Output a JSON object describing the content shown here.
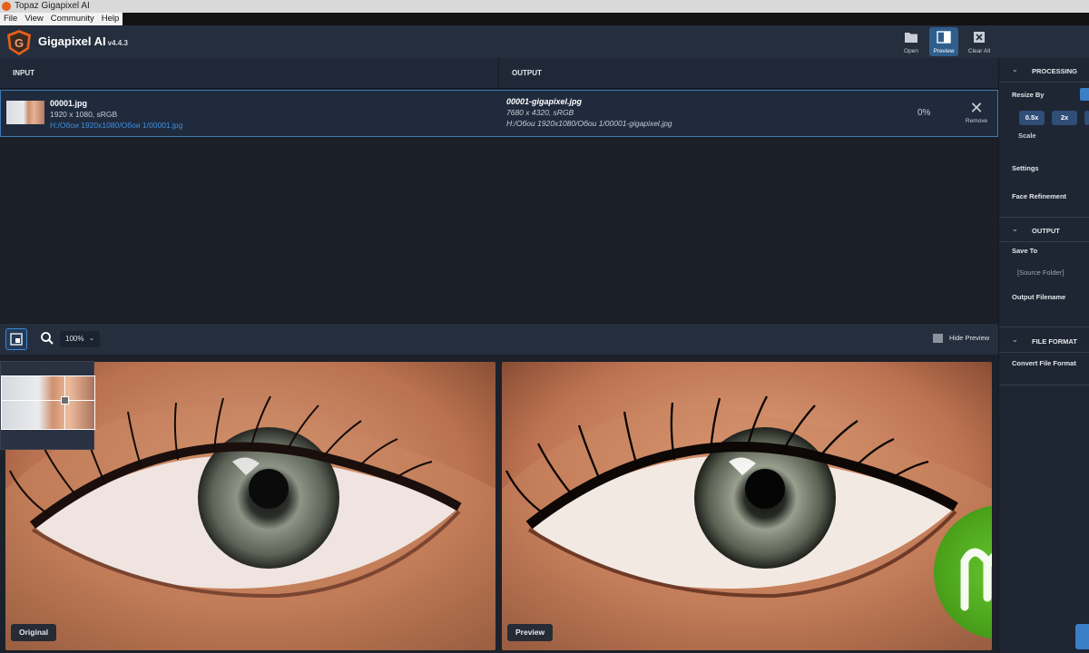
{
  "window": {
    "title": "Topaz Gigapixel AI"
  },
  "menu": {
    "items": [
      "File",
      "View",
      "Community",
      "Help"
    ]
  },
  "app": {
    "name": "Gigapixel AI",
    "version": "v4.4.3"
  },
  "toolbar": {
    "open_label": "Open",
    "preview_label": "Preview",
    "clear_label": "Clear All"
  },
  "table": {
    "input_header": "INPUT",
    "output_header": "OUTPUT",
    "row": {
      "input_name": "00001.jpg",
      "input_meta": "1920 x 1080, sRGB",
      "input_path": "H:/Обои 1920x1080/Обои 1/00001.jpg",
      "output_name": "00001-gigapixel.jpg",
      "output_meta": "7680 x 4320, sRGB",
      "output_path": "H:/Обои 1920x1080/Обои 1/00001-gigapixel.jpg",
      "progress": "0%",
      "remove_label": "Remove"
    }
  },
  "preview_toolbar": {
    "zoom": "100%",
    "hide_label": "Hide Preview"
  },
  "preview": {
    "original_label": "Original",
    "preview_label": "Preview"
  },
  "right_panel": {
    "processing_header": "PROCESSING",
    "resize_by": "Resize By",
    "scale_buttons": [
      "0.5x",
      "2x"
    ],
    "scale_label": "Scale",
    "settings": "Settings",
    "face_refinement": "Face Refinement",
    "output_header": "OUTPUT",
    "save_to": "Save To",
    "save_to_value": "[Source Folder]",
    "output_filename": "Output Filename",
    "file_format_header": "FILE FORMAT",
    "convert_file_format": "Convert File Format"
  },
  "colors": {
    "accent": "#3b7fc9",
    "header_bg": "#252e3d",
    "row_border": "#3f78b3",
    "path_link": "#3e8fe0"
  }
}
